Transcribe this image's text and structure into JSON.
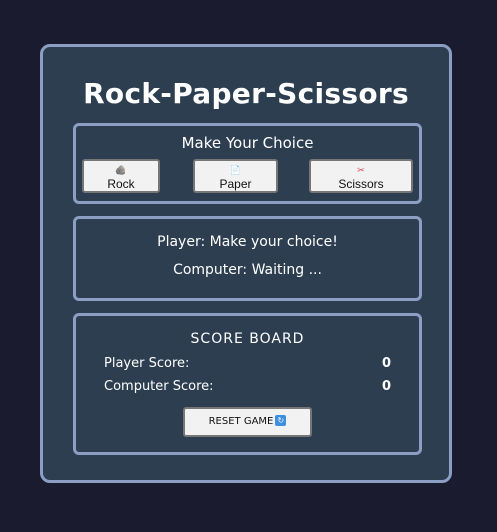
{
  "game": {
    "title": "Rock-Paper-Scissors"
  },
  "choice_panel": {
    "heading": "Make Your Choice",
    "buttons": [
      {
        "label": "Rock",
        "icon": "rock-icon",
        "glyph": "🪨"
      },
      {
        "label": "Paper",
        "icon": "paper-icon",
        "glyph": "📄"
      },
      {
        "label": "Scissors",
        "icon": "scissors-icon",
        "glyph": "✂"
      }
    ]
  },
  "result_panel": {
    "player_status": "Player: Make your choice!",
    "computer_status": "Computer: Waiting ..."
  },
  "score_board": {
    "heading": "SCORE BOARD",
    "player_label": "Player Score:",
    "player_score": "0",
    "computer_label": "Computer Score:",
    "computer_score": "0",
    "reset_label": "RESET GAME",
    "reset_icon": "refresh-icon",
    "reset_glyph": "↻"
  },
  "colors": {
    "page_background": "#1a1b2e",
    "card_background": "#2c3e50",
    "border": "#8c9ec4",
    "text": "#ffffff",
    "button_background": "#f2f2f2"
  }
}
